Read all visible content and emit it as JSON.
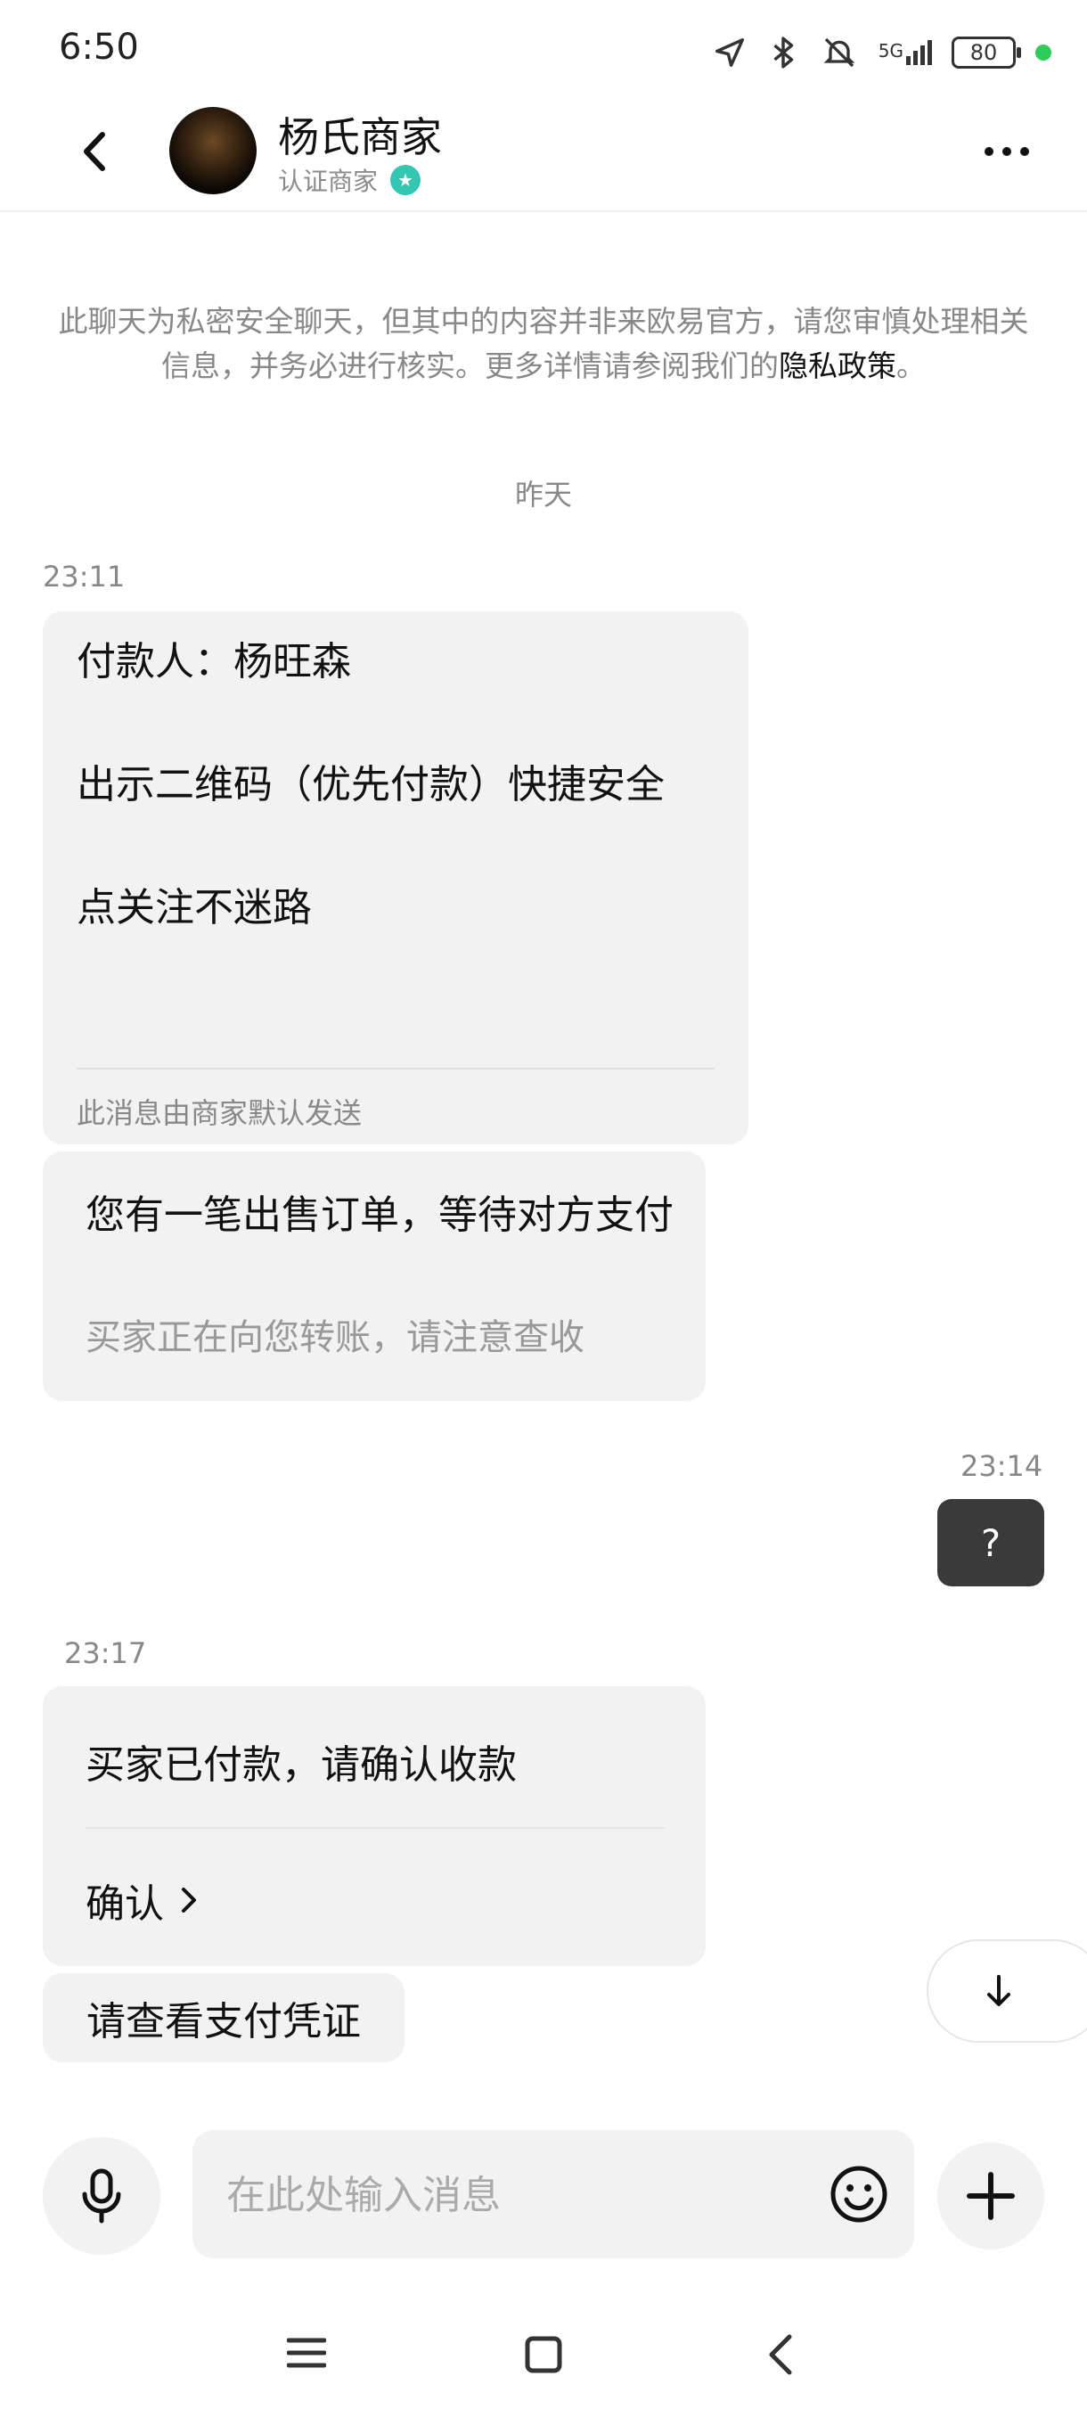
{
  "status_bar": {
    "time": "6:50",
    "network": "5G",
    "battery": "80"
  },
  "header": {
    "title": "杨氏商家",
    "subtitle": "认证商家"
  },
  "notice": {
    "text": "此聊天为私密安全聊天，但其中的内容并非来欧易官方，请您审慎处理相关信息，并务必进行核实。更多详情请参阅我们的",
    "link": "隐私政策",
    "end": "。"
  },
  "date_separator": "昨天",
  "messages": [
    {
      "time": "23:11",
      "lines": [
        "付款人：杨旺森",
        "出示二维码（优先付款）快捷安全",
        "点关注不迷路"
      ],
      "footer": "此消息由商家默认发送"
    },
    {
      "title": "您有一笔出售订单，等待对方支付",
      "sub": "买家正在向您转账，请注意查收"
    },
    {
      "time": "23:14",
      "text": "?"
    },
    {
      "time": "23:17",
      "title": "买家已付款，请确认收款",
      "action": "确认"
    },
    {
      "text": "请查看支付凭证"
    }
  ],
  "input": {
    "placeholder": "在此处输入消息"
  },
  "colors": {
    "green_dot": "#2fcc5a",
    "verified_badge": "#33c6b3",
    "outgoing_bubble": "#3a3a3a",
    "incoming_bubble": "#f2f2f2"
  }
}
